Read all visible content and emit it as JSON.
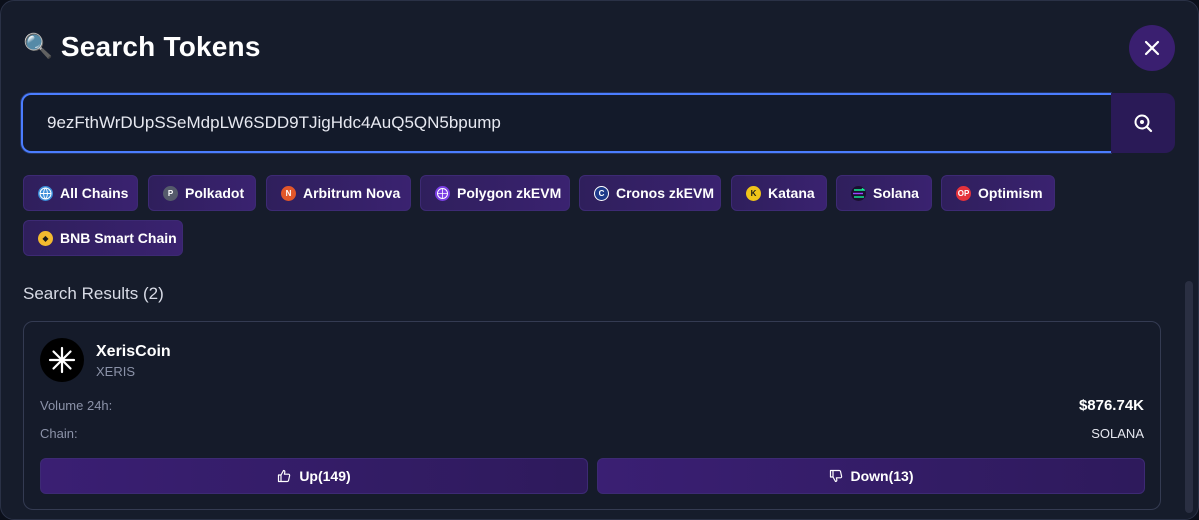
{
  "header": {
    "emoji": "🔍",
    "title": "Search Tokens"
  },
  "search": {
    "value": "9ezFthWrDUpSSeMdpLW6SDD9TJigHdc4AuQ5QN5bpump",
    "placeholder": ""
  },
  "chains": [
    {
      "label": "All Chains",
      "icon": "globe-icon",
      "color": "#3a8dd8"
    },
    {
      "label": "Polkadot",
      "icon": "polkadot-icon",
      "color": "#555b6b"
    },
    {
      "label": "Arbitrum Nova",
      "icon": "arbitrum-nova-icon",
      "color": "#e2572a"
    },
    {
      "label": "Polygon zkEVM",
      "icon": "polygon-zkevm-icon",
      "color": "#7b3fe4"
    },
    {
      "label": "Cronos zkEVM",
      "icon": "cronos-zkevm-icon",
      "color": "#ffffff"
    },
    {
      "label": "Katana",
      "icon": "katana-icon",
      "color": "#f0c419"
    },
    {
      "label": "Solana",
      "icon": "solana-icon",
      "color": "#14f195"
    },
    {
      "label": "Optimism",
      "icon": "optimism-icon",
      "color": "#e5323b"
    },
    {
      "label": "BNB Smart Chain",
      "icon": "bnb-icon",
      "color": "#f3ba2f"
    }
  ],
  "results": {
    "label": "Search Results (2)",
    "items": [
      {
        "name": "XerisCoin",
        "symbol": "XERIS",
        "volume_label": "Volume 24h:",
        "volume_value": "$876.74K",
        "chain_label": "Chain:",
        "chain_value": "SOLANA",
        "up_label": "Up(149)",
        "down_label": "Down(13)"
      }
    ]
  },
  "colors": {
    "accent": "#4b7dff",
    "button": "#3a1f70"
  }
}
